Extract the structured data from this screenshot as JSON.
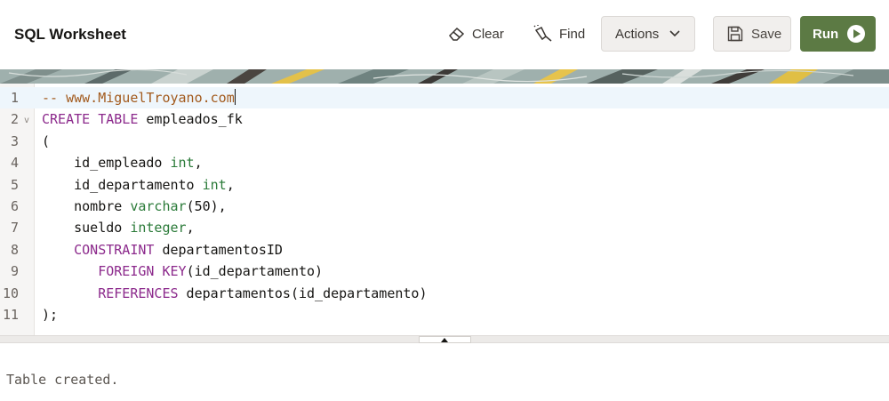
{
  "header": {
    "title": "SQL Worksheet",
    "clear_label": "Clear",
    "find_label": "Find",
    "actions_label": "Actions",
    "save_label": "Save",
    "run_label": "Run"
  },
  "colors": {
    "run_button": "#5c7a44",
    "keyword": "#8c2a8c",
    "type": "#2a7a38",
    "comment": "#a25a1d",
    "active_line": "#eef6fc"
  },
  "editor": {
    "lines": [
      {
        "n": "1",
        "tokens": [
          {
            "t": "-- www.MiguelTroyano.com",
            "c": "comment"
          }
        ],
        "cursor": true
      },
      {
        "n": "2",
        "fold": "v",
        "tokens": [
          {
            "t": "CREATE TABLE",
            "c": "kw"
          },
          {
            "t": " empleados_fk",
            "c": "plain"
          }
        ]
      },
      {
        "n": "3",
        "tokens": [
          {
            "t": "(",
            "c": "plain"
          }
        ]
      },
      {
        "n": "4",
        "tokens": [
          {
            "t": "    id_empleado ",
            "c": "plain"
          },
          {
            "t": "int",
            "c": "type"
          },
          {
            "t": ",",
            "c": "plain"
          }
        ]
      },
      {
        "n": "5",
        "tokens": [
          {
            "t": "    id_departamento ",
            "c": "plain"
          },
          {
            "t": "int",
            "c": "type"
          },
          {
            "t": ",",
            "c": "plain"
          }
        ]
      },
      {
        "n": "6",
        "tokens": [
          {
            "t": "    nombre ",
            "c": "plain"
          },
          {
            "t": "varchar",
            "c": "type"
          },
          {
            "t": "(50),",
            "c": "plain"
          }
        ]
      },
      {
        "n": "7",
        "tokens": [
          {
            "t": "    sueldo ",
            "c": "plain"
          },
          {
            "t": "integer",
            "c": "type"
          },
          {
            "t": ",",
            "c": "plain"
          }
        ]
      },
      {
        "n": "8",
        "tokens": [
          {
            "t": "    ",
            "c": "plain"
          },
          {
            "t": "CONSTRAINT",
            "c": "kw"
          },
          {
            "t": " departamentosID",
            "c": "plain"
          }
        ]
      },
      {
        "n": "9",
        "tokens": [
          {
            "t": "       ",
            "c": "plain"
          },
          {
            "t": "FOREIGN KEY",
            "c": "kw"
          },
          {
            "t": "(id_departamento)",
            "c": "plain"
          }
        ]
      },
      {
        "n": "10",
        "tokens": [
          {
            "t": "       ",
            "c": "plain"
          },
          {
            "t": "REFERENCES",
            "c": "kw"
          },
          {
            "t": " departamentos(id_departamento)",
            "c": "plain"
          }
        ]
      },
      {
        "n": "11",
        "tokens": [
          {
            "t": ");",
            "c": "plain"
          }
        ]
      }
    ]
  },
  "output": {
    "message": "Table created."
  }
}
